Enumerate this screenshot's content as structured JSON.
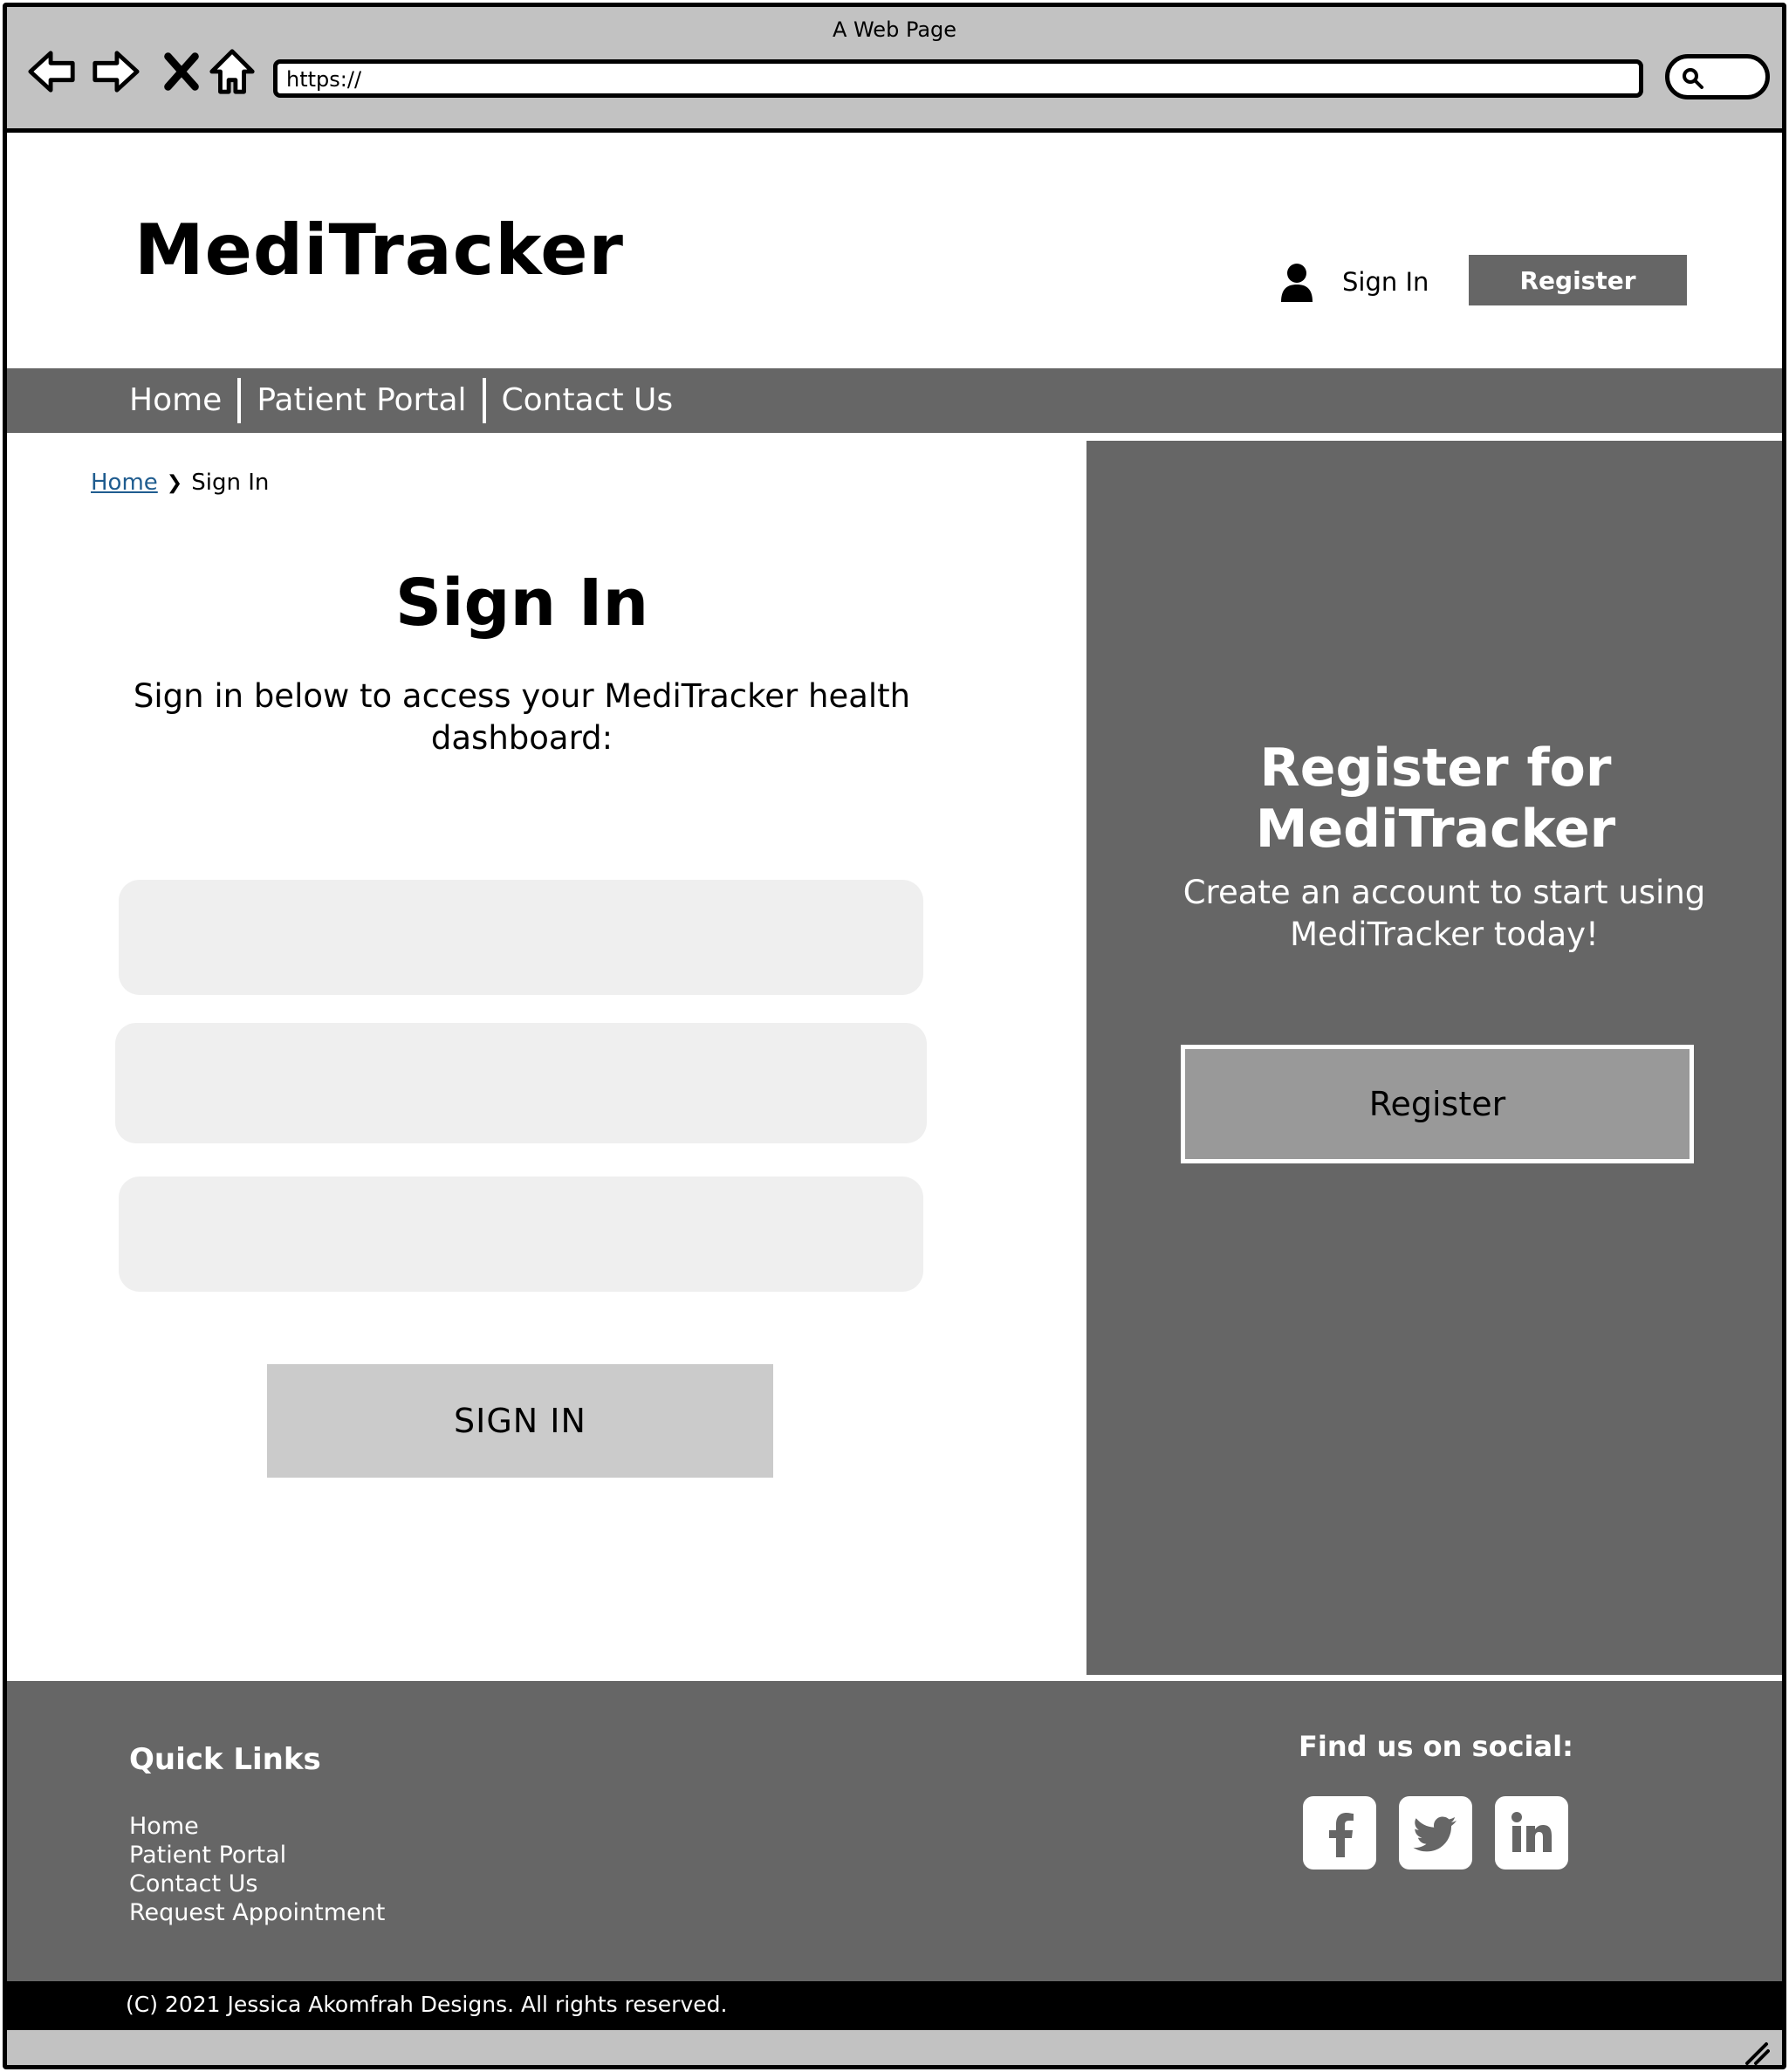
{
  "browser": {
    "window_title": "A Web Page",
    "url": "https://"
  },
  "header": {
    "logo": "MediTracker",
    "sign_in_label": "Sign In",
    "register_label": "Register"
  },
  "nav": {
    "items": [
      {
        "label": "Home"
      },
      {
        "label": "Patient Portal"
      },
      {
        "label": "Contact Us"
      }
    ]
  },
  "breadcrumb": {
    "home": "Home",
    "current": "Sign In"
  },
  "signin": {
    "title": "Sign In",
    "description": "Sign in below to access your MediTracker health dashboard:",
    "button_label": "SIGN IN"
  },
  "register_panel": {
    "title": "Register for MediTracker",
    "description": "Create an account to start using MediTracker today!",
    "button_label": "Register"
  },
  "footer": {
    "quick_links_title": "Quick Links",
    "quick_links": [
      {
        "label": "Home"
      },
      {
        "label": "Patient Portal"
      },
      {
        "label": "Contact Us"
      },
      {
        "label": "Request Appointment"
      }
    ],
    "social_title": "Find us on social:",
    "social_icons": [
      "facebook-icon",
      "twitter-icon",
      "linkedin-icon"
    ],
    "copyright": "(C) 2021 Jessica Akomfrah Designs. All rights reserved."
  },
  "colors": {
    "chrome": "#c2c2c2",
    "primary_gray": "#666666",
    "field_bg": "#efefef",
    "button_gray": "#cbcbcb",
    "register_button": "#999999",
    "link_blue": "#1f5c8f"
  }
}
